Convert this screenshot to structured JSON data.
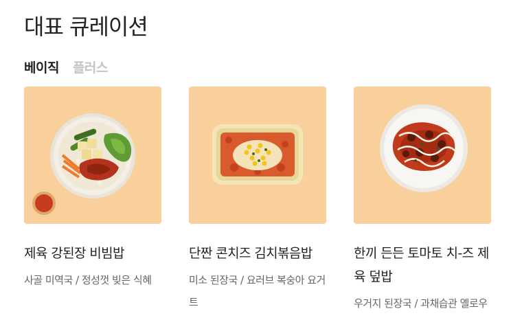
{
  "section": {
    "title": "대표 큐레이션",
    "tabs": [
      {
        "label": "베이직",
        "active": true
      },
      {
        "label": "플러스",
        "active": false
      }
    ]
  },
  "cards": [
    {
      "name": "제육 강된장 비빔밥",
      "sub": "사골 미역국 / 정성껏 빚은 식혜",
      "image": "bibimbap-bowl"
    },
    {
      "name": "단짠 콘치즈 김치볶음밥",
      "sub": "미소 된장국 / 요러브 복숭아 요거트",
      "image": "kimchi-rice-tray"
    },
    {
      "name": "한끼 든든 토마토 치-즈 제육 덮밥",
      "sub": "우거지 된장국 / 과채습관 옐로우",
      "image": "tomato-cheese-plate"
    }
  ],
  "colors": {
    "card_bg": "#f9cf9b",
    "text": "#222222",
    "sub_text": "#666666",
    "inactive_tab": "#c4c4c4"
  }
}
